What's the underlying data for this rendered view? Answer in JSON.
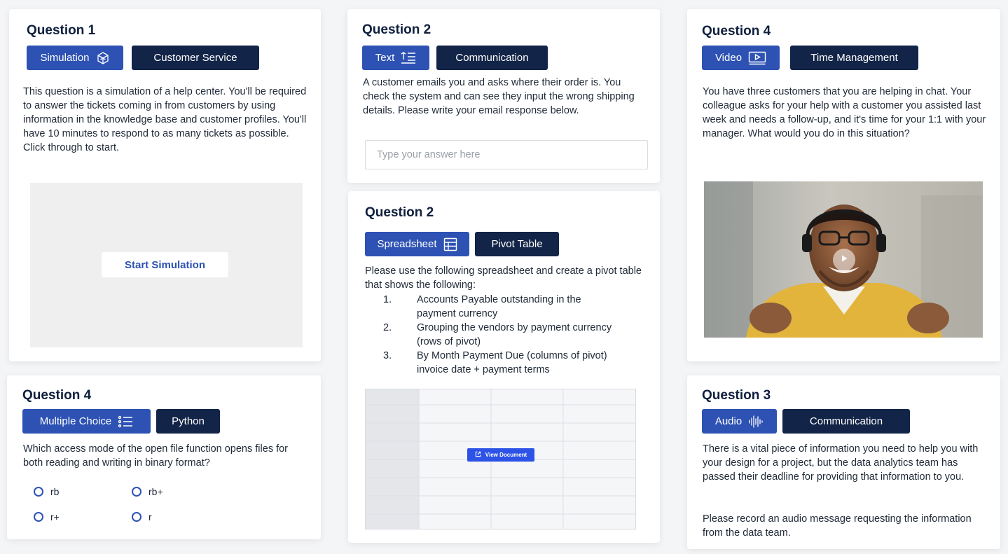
{
  "q1": {
    "title": "Question 1",
    "type_label": "Simulation",
    "type_icon": "cube-icon",
    "skill_label": "Customer Service",
    "description": "This question is a simulation of a help center. You'll be required to answer the tickets coming in from customers by using information in the knowledge base and customer profiles. You'll have 10 minutes to respond to as many tickets as possible. Click through to start.",
    "start_button": "Start Simulation"
  },
  "q2_text": {
    "title": "Question 2",
    "type_label": "Text",
    "type_icon": "text-lines-icon",
    "skill_label": "Communication",
    "description": "A customer emails you and asks where their order is. You check the system and can see they input the wrong shipping details. Please write your email response below.",
    "input_placeholder": "Type your answer here",
    "input_value": ""
  },
  "q2_sheet": {
    "title": "Question 2",
    "type_label": "Spreadsheet",
    "type_icon": "table-icon",
    "skill_label": "Pivot Table",
    "intro": "Please use the following spreadsheet and create a pivot table that shows the following:",
    "items": [
      {
        "num": "1.",
        "text": "Accounts Payable outstanding in the payment currency"
      },
      {
        "num": "2.",
        "text": "Grouping the vendors by payment currency (rows of pivot)"
      },
      {
        "num": "3.",
        "text": "By Month Payment Due (columns of pivot) invoice date + payment terms"
      }
    ],
    "view_button": "View Document"
  },
  "q4_mc": {
    "title": "Question 4",
    "type_label": "Multiple Choice",
    "type_icon": "list-icon",
    "skill_label": "Python",
    "question": "Which access mode of the open file function opens files for both reading and writing in binary format?",
    "options": [
      "rb",
      "rb+",
      "r+",
      "r"
    ]
  },
  "q4_video": {
    "title": "Question 4",
    "type_label": "Video",
    "type_icon": "video-play-icon",
    "skill_label": "Time Management",
    "description": "You have three customers that you are helping in chat. Your colleague asks for your help with a customer you assisted last week and needs a follow-up, and it's time for your 1:1 with your manager. What would you do in this situation?"
  },
  "q3_audio": {
    "title": "Question 3",
    "type_label": "Audio",
    "type_icon": "waveform-icon",
    "skill_label": "Communication",
    "description_1": "There is a vital piece of information you need to help you with your design for a project, but the data analytics team has passed their deadline for providing that information to you.",
    "description_2": "Please record an audio message requesting the information from the data team."
  },
  "colors": {
    "primary_blue": "#2d52b3",
    "navy": "#122447",
    "title": "#0f1f3d"
  }
}
